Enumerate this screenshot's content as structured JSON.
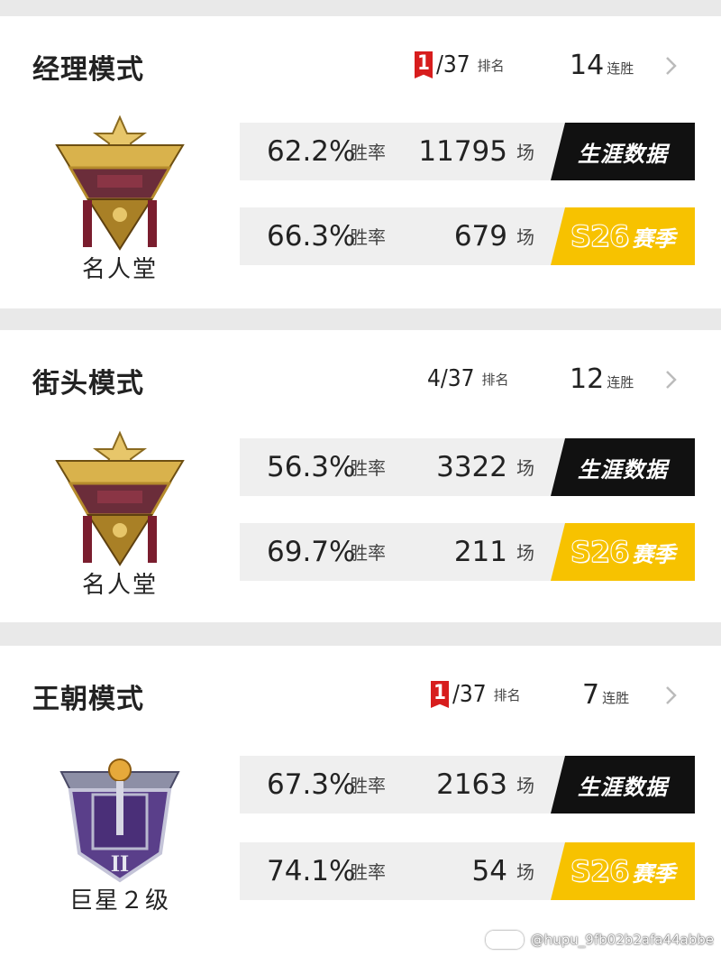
{
  "modes": [
    {
      "title": "经理模式",
      "rank_highlight": true,
      "rank": "1",
      "rank_total": "/37",
      "rank_label": "排名",
      "streak": "14",
      "streak_label": "连胜",
      "badge_name": "名人堂",
      "badge_icon": "hall-of-fame-badge",
      "rows": [
        {
          "rate": "62.2%",
          "rate_label": "胜率",
          "games": "11795",
          "games_label": "场",
          "button": "生涯数据",
          "type": "career"
        },
        {
          "rate": "66.3%",
          "rate_label": "胜率",
          "games": "679",
          "games_label": "场",
          "button_s": "S26",
          "button": "赛季",
          "type": "season"
        }
      ]
    },
    {
      "title": "街头模式",
      "rank_highlight": false,
      "rank": "4",
      "rank_total": "/37",
      "rank_label": "排名",
      "streak": "12",
      "streak_label": "连胜",
      "badge_name": "名人堂",
      "badge_icon": "hall-of-fame-badge",
      "rows": [
        {
          "rate": "56.3%",
          "rate_label": "胜率",
          "games": "3322",
          "games_label": "场",
          "button": "生涯数据",
          "type": "career"
        },
        {
          "rate": "69.7%",
          "rate_label": "胜率",
          "games": "211",
          "games_label": "场",
          "button_s": "S26",
          "button": "赛季",
          "type": "season"
        }
      ]
    },
    {
      "title": "王朝模式",
      "rank_highlight": true,
      "rank": "1",
      "rank_total": "/37",
      "rank_label": "排名",
      "streak": "7",
      "streak_label": "连胜",
      "badge_name": "巨星２级",
      "badge_icon": "superstar-badge",
      "rows": [
        {
          "rate": "67.3%",
          "rate_label": "胜率",
          "games": "2163",
          "games_label": "场",
          "button": "生涯数据",
          "type": "career"
        },
        {
          "rate": "74.1%",
          "rate_label": "胜率",
          "games": "54",
          "games_label": "场",
          "button_s": "S26",
          "button": "赛季",
          "type": "season"
        }
      ]
    }
  ],
  "watermark": "@hupu_9fb02b2afa44abbe",
  "colors": {
    "accent_red": "#d71d1d",
    "season_yellow": "#f7c200",
    "career_black": "#111111"
  }
}
